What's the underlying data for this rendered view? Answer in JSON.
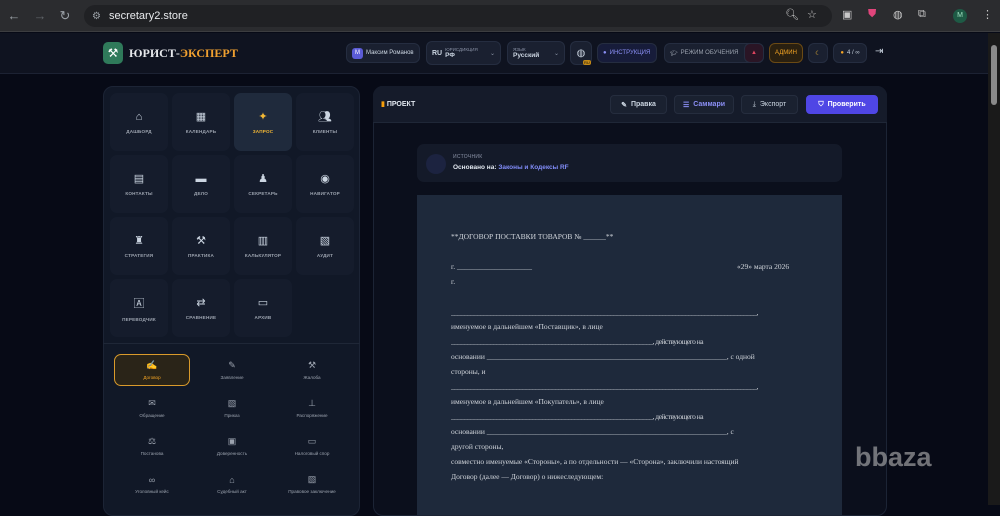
{
  "browser": {
    "url": "secretary2.store",
    "profile": "M"
  },
  "header": {
    "brand_main": "ЮРИСТ-",
    "brand_accent": "ЭКСПЕРТ",
    "user_initial": "М",
    "user_name": "Максим Романов",
    "jurisdiction_label": "ЮРИСДИКЦИЯ",
    "jurisdiction_code": "RU",
    "jurisdiction_value": "РФ",
    "language_label": "ЯЗЫК",
    "language_value": "Русский",
    "globe_badge": "RU",
    "instructions": "ИНСТРУКЦИЯ",
    "training": "РЕЖИМ ОБУЧЕНИЯ",
    "admin": "АДМИН",
    "credits": "4 / ∞"
  },
  "nav_tiles": [
    {
      "label": "ДАШБОРД",
      "icon": "home-icon"
    },
    {
      "label": "КАЛЕНДАРЬ",
      "icon": "calendar-icon"
    },
    {
      "label": "ЗАПРОС",
      "icon": "magic-wand-icon",
      "active": true
    },
    {
      "label": "КЛИЕНТЫ",
      "icon": "users-icon"
    },
    {
      "label": "КОНТАКТЫ",
      "icon": "address-book-icon"
    },
    {
      "label": "ДЕЛО",
      "icon": "briefcase-icon"
    },
    {
      "label": "СЕКРЕТАРЬ",
      "icon": "user-tie-icon"
    },
    {
      "label": "НАВИГАТОР",
      "icon": "compass-icon"
    },
    {
      "label": "СТРАТЕГИЯ",
      "icon": "chess-icon"
    },
    {
      "label": "ПРАКТИКА",
      "icon": "gavel-icon"
    },
    {
      "label": "КАЛЬКУЛЯТОР",
      "icon": "calculator-icon"
    },
    {
      "label": "АУДИТ",
      "icon": "file-shield-icon"
    },
    {
      "label": "ПЕРЕВОДЧИК",
      "icon": "language-icon"
    },
    {
      "label": "СРАВНЕНИЕ",
      "icon": "compare-icon"
    },
    {
      "label": "АРХИВ",
      "icon": "archive-icon"
    }
  ],
  "doc_types": [
    {
      "label": "Договор",
      "icon": "file-signature-icon",
      "active": true
    },
    {
      "label": "Заявление",
      "icon": "file-pen-icon"
    },
    {
      "label": "Жалоба",
      "icon": "gavel-icon"
    },
    {
      "label": "Обращение",
      "icon": "envelope-icon"
    },
    {
      "label": "Приказ",
      "icon": "file-shield-icon"
    },
    {
      "label": "Распоряжение",
      "icon": "sitemap-icon"
    },
    {
      "label": "Постанова",
      "icon": "scales-icon"
    },
    {
      "label": "Доверенность",
      "icon": "id-card-icon"
    },
    {
      "label": "Налоговый спор",
      "icon": "money-icon"
    },
    {
      "label": "Уголовный кейс",
      "icon": "handcuffs-icon"
    },
    {
      "label": "Судебный акт",
      "icon": "courthouse-icon"
    },
    {
      "label": "Правовое заключение",
      "icon": "file-check-icon"
    }
  ],
  "main": {
    "title": "ПРОЕКТ",
    "edit": "Правка",
    "summary": "Саммари",
    "export": "Экспорт",
    "check": "Проверить",
    "source_label": "ИСТОЧНИК",
    "source_prefix": "Основано на:",
    "source_link": "Законы и Кодексы RF"
  },
  "document": {
    "lines": [
      "**ДОГОВОР ПОСТАВКИ ТОВАРОВ № ______**",
      "г. ____________________",
      "«29» марта 2026",
      "г.",
      "______________________________________________________________________________________________,",
      "именуемое в дальнейшем «Поставщик», в лице",
      "______________________________________________________________, действующего на",
      "основании ________________________________________________________________, с одной",
      "стороны, и",
      "______________________________________________________________________________________________,",
      "именуемое в дальнейшем «Покупатель», в лице",
      "______________________________________________________________, действующего на",
      "основании ________________________________________________________________, с",
      "другой стороны,",
      "совместно именуемые «Стороны», а по отдельности — «Сторона», заключили настоящий",
      "Договор (далее — Договор) о нижеследующем:"
    ]
  },
  "colors": {
    "accent": "#f5a524",
    "primary": "#4f46e5",
    "link": "#818cf8",
    "background": "#070a16"
  },
  "watermark": "bbaza"
}
